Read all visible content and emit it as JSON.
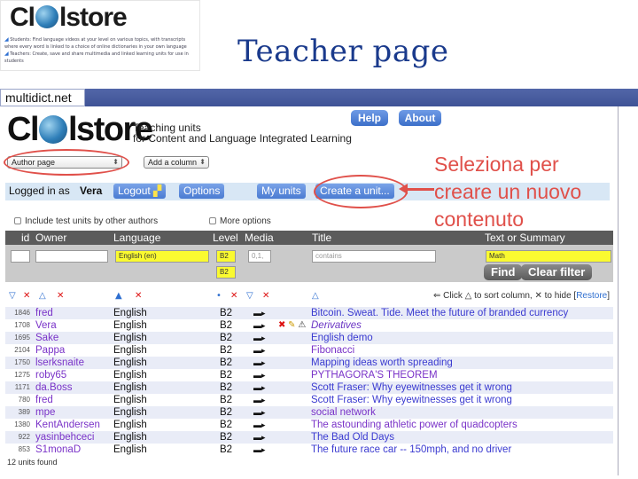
{
  "slide": {
    "title": "Teacher page",
    "logo_text_a": "Cl",
    "logo_text_b": "lstore",
    "logo_line1": "Students: Find language videos at your level on various topics, with transcripts where every word is linked to a choice of online dictionaries in your own language",
    "logo_line2": "Teachers: Create, save and share multimedia and linked learning units for use in students"
  },
  "browser": {
    "site": "multidict.net"
  },
  "header": {
    "logo_a": "Cl",
    "logo_b": "lstore",
    "tagline_1": "Teaching units",
    "tagline_2": "for Content and Language Integrated Learning",
    "help": "Help",
    "about": "About",
    "page_select": "Author page",
    "add_column": "Add a column"
  },
  "menubar": {
    "logged_in_as": "Logged in as",
    "user": "Vera",
    "logout": "Logout",
    "options": "Options",
    "my_units": "My units",
    "create_unit": "Create a unit..."
  },
  "options": {
    "include_test": "Include test units by other authors",
    "more_options": "More options"
  },
  "table": {
    "headers": {
      "id": "id",
      "owner": "Owner",
      "language": "Language",
      "level": "Level",
      "media": "Media",
      "title": "Title",
      "text": "Text or Summary"
    },
    "filters": {
      "language": "English (en)",
      "level_a": "B2",
      "level_b": "B2",
      "media": "0,1,",
      "title_placeholder": "contains",
      "text_value": "Math"
    },
    "find": "Find",
    "clear": "Clear filter",
    "sort_hint_a": "Click",
    "sort_hint_b": "to sort column,",
    "sort_hint_c": "to hide",
    "restore": "Restore",
    "rows": [
      {
        "id": "1846",
        "owner": "fred",
        "language": "English",
        "level": "B2",
        "title": "Bitcoin. Sweat. Tide. Meet the future of branded currency"
      },
      {
        "id": "1708",
        "owner": "Vera",
        "language": "English",
        "level": "B2",
        "title": "Derivatives"
      },
      {
        "id": "1695",
        "owner": "Sake",
        "language": "English",
        "level": "B2",
        "title": "English demo"
      },
      {
        "id": "2104",
        "owner": "Pappa",
        "language": "English",
        "level": "B2",
        "title": "Fibonacci"
      },
      {
        "id": "1750",
        "owner": "lserksnaite",
        "language": "English",
        "level": "B2",
        "title": "Mapping ideas worth spreading"
      },
      {
        "id": "1275",
        "owner": "roby65",
        "language": "English",
        "level": "B2",
        "title": "PYTHAGORA'S THEOREM"
      },
      {
        "id": "1171",
        "owner": "da.Boss",
        "language": "English",
        "level": "B2",
        "title": "Scott Fraser: Why eyewitnesses get it wrong"
      },
      {
        "id": "780",
        "owner": "fred",
        "language": "English",
        "level": "B2",
        "title": "Scott Fraser: Why eyewitnesses get it wrong"
      },
      {
        "id": "389",
        "owner": "mpe",
        "language": "English",
        "level": "B2",
        "title": "social network"
      },
      {
        "id": "1380",
        "owner": "KentAndersen",
        "language": "English",
        "level": "B2",
        "title": "The astounding athletic power of quadcopters"
      },
      {
        "id": "922",
        "owner": "yasinbehceci",
        "language": "English",
        "level": "B2",
        "title": "The Bad Old Days"
      },
      {
        "id": "853",
        "owner": "S1monaD",
        "language": "English",
        "level": "B2",
        "title": "The future race car -- 150mph, and no driver"
      }
    ],
    "footer": "12 units found"
  },
  "annotation": {
    "line1": "Seleziona per",
    "line2": "creare un nuovo",
    "line3": "contenuto"
  },
  "colors": {
    "accent_blue": "#3c6fc9",
    "annotation_red": "#e0504a",
    "owner_purple": "#7a33c8",
    "title_blue": "#3a3ad0"
  }
}
